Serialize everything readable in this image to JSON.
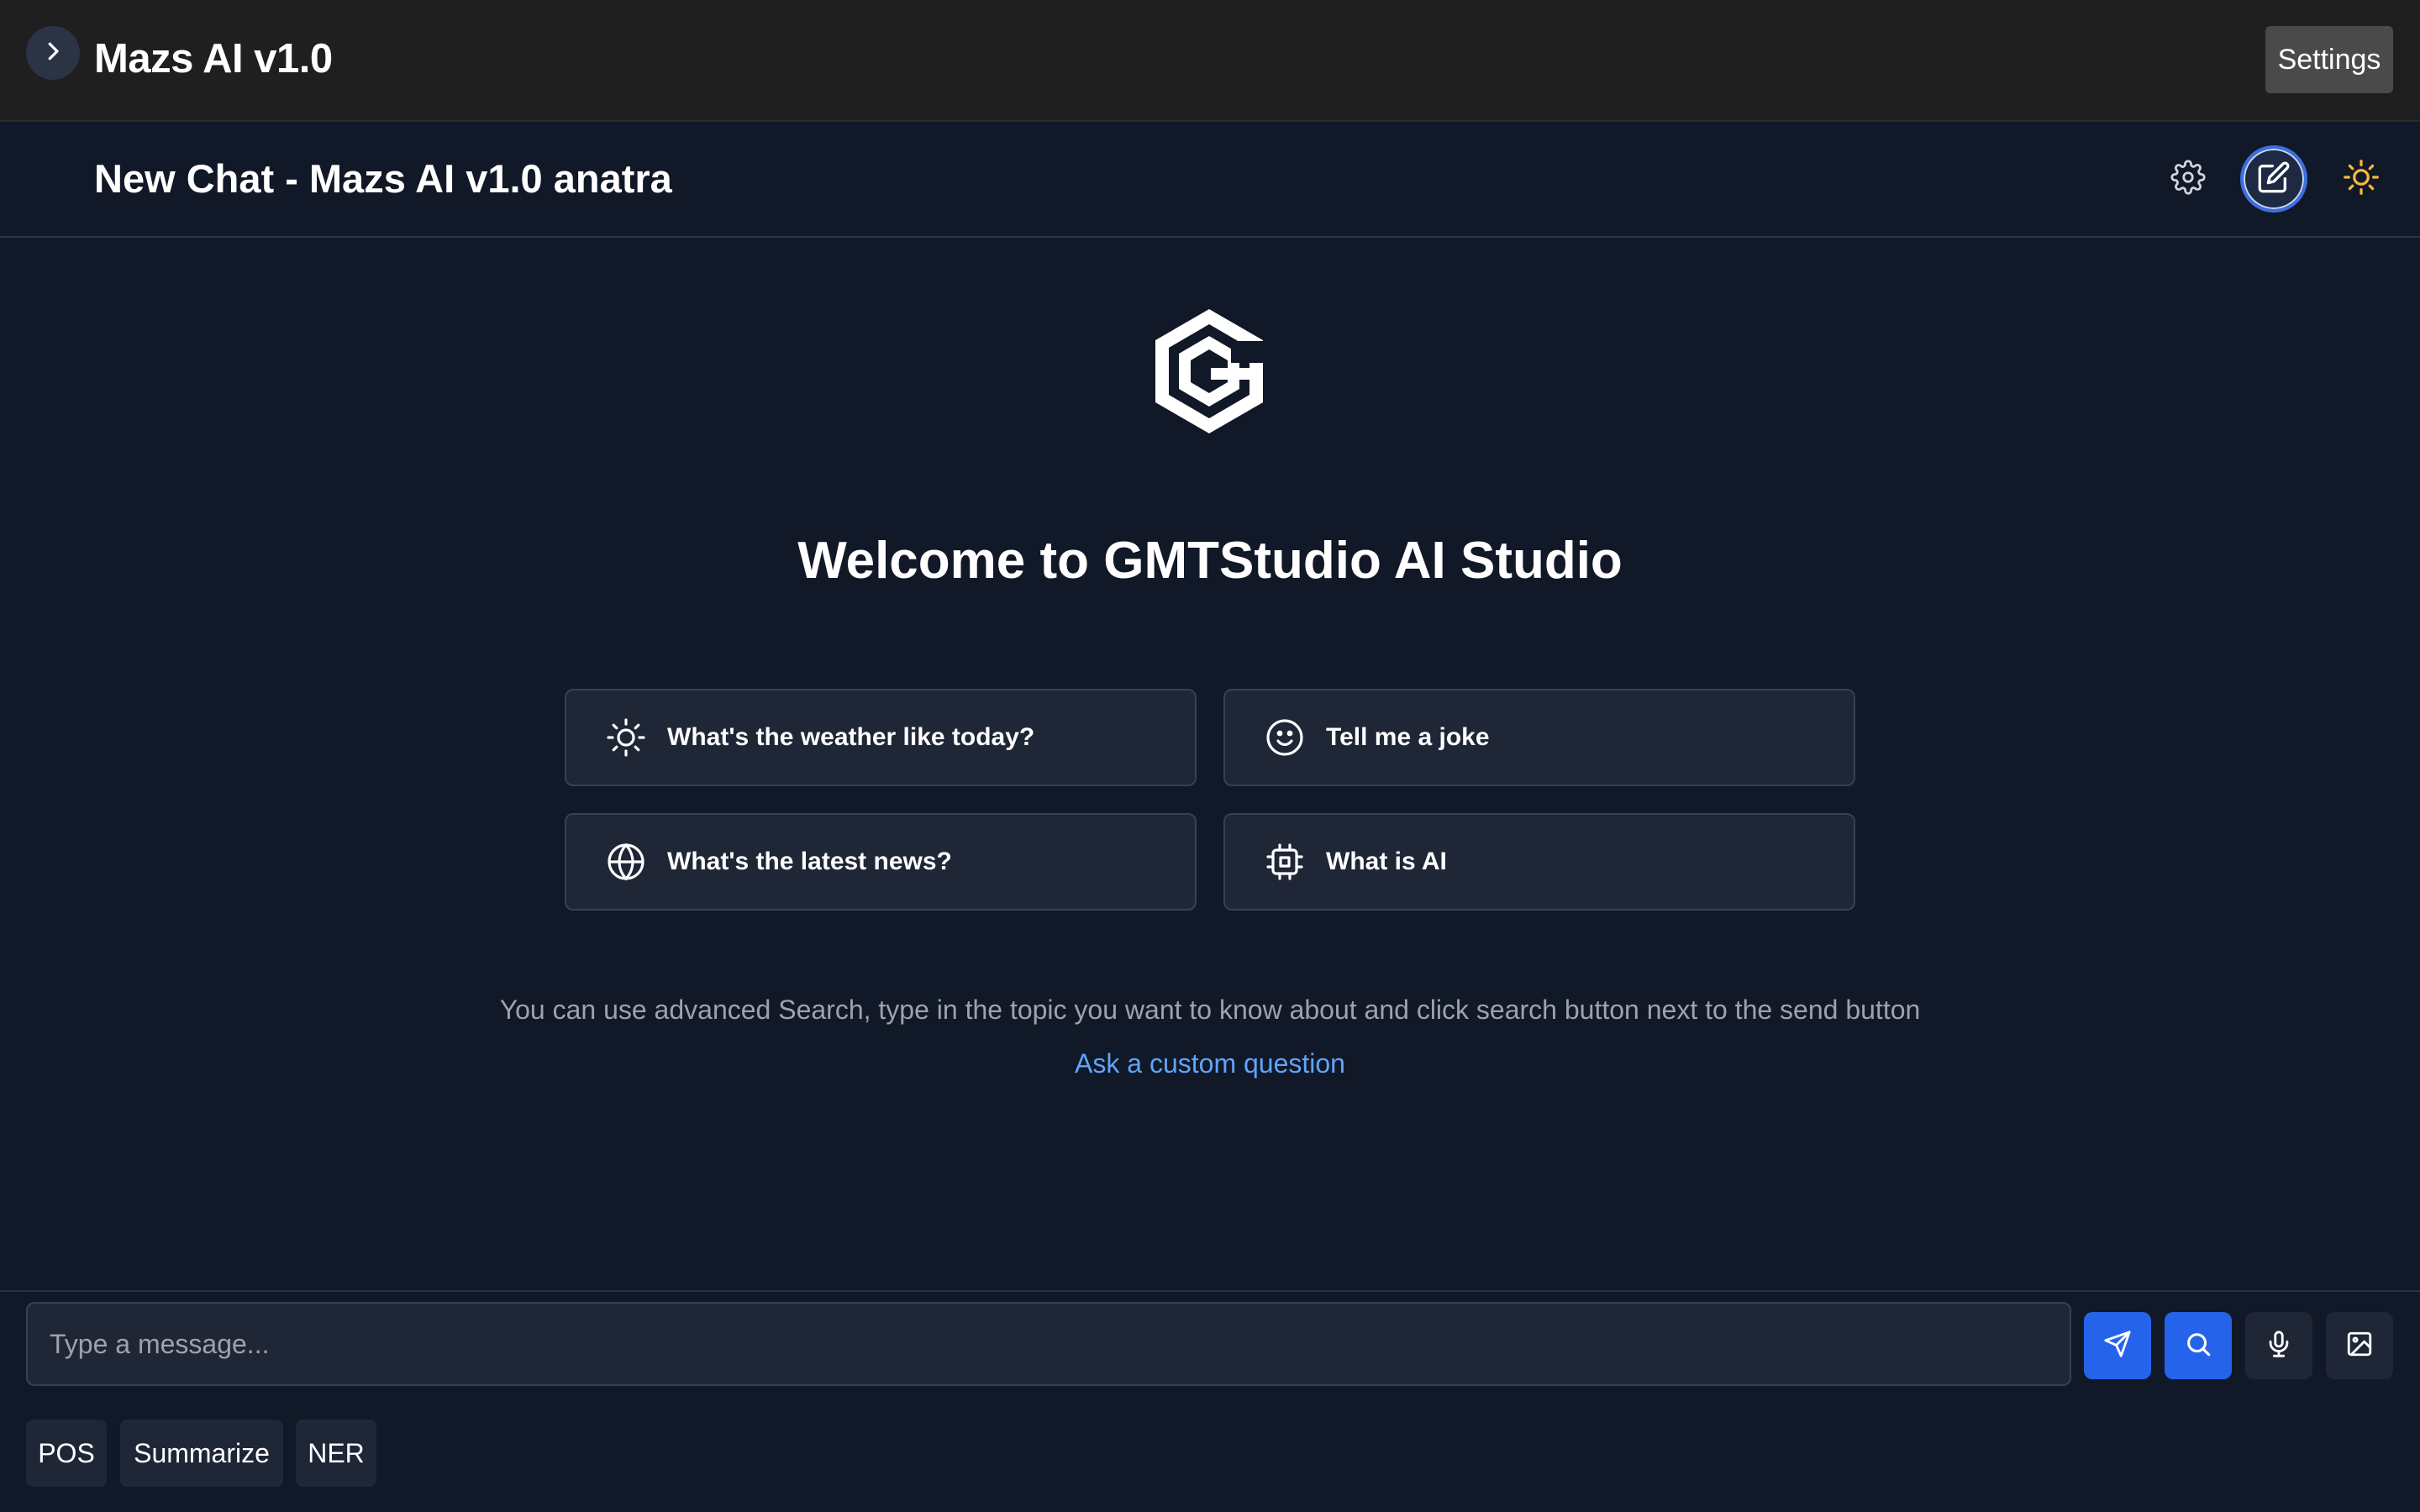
{
  "topbar": {
    "title": "Mazs AI v1.0",
    "settings_label": "Settings",
    "toggle_icon": "chevron-right-icon"
  },
  "chat_header": {
    "title": "New Chat - Mazs AI v1.0 anatra",
    "icons": [
      "gear-icon",
      "edit-icon",
      "sun-icon"
    ],
    "sun_color": "#f5b83d",
    "edit_ring_color": "#3b6ee0"
  },
  "main": {
    "logo": "gmtstudio-logo",
    "welcome": "Welcome to GMTStudio AI Studio",
    "suggestions": [
      {
        "label": "What's the weather like today?",
        "icon": "sun-icon"
      },
      {
        "label": "Tell me a joke",
        "icon": "smile-icon"
      },
      {
        "label": "What's the latest news?",
        "icon": "globe-icon"
      },
      {
        "label": "What is AI",
        "icon": "cpu-icon"
      }
    ],
    "hint": "You can use advanced Search, type in the topic you want to know about and click search button next to the send button",
    "custom_link": "Ask a custom question"
  },
  "composer": {
    "placeholder": "Type a message...",
    "actions": [
      "send-icon",
      "search-icon",
      "mic-icon",
      "image-icon"
    ],
    "accent": "#2563eb",
    "tools": [
      "POS",
      "Summarize",
      "NER"
    ]
  }
}
